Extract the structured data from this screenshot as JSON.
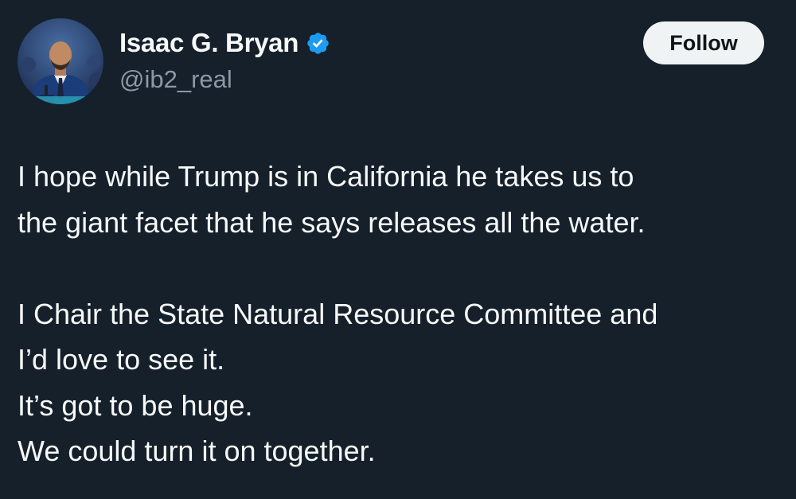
{
  "tweet": {
    "author": {
      "display_name": "Isaac G. Bryan",
      "handle": "@ib2_real",
      "verified": true,
      "verified_color": "#1d9bf0",
      "avatar_icon": "profile-photo-man-at-podium"
    },
    "follow_label": "Follow",
    "paragraphs": [
      {
        "lines": [
          "I hope while Trump is in California he takes us to",
          "the giant facet that he says releases all the water."
        ]
      },
      {
        "lines": [
          "I Chair the State Natural Resource Committee and",
          "I’d love to see it.",
          "It’s got to be huge.",
          "We could turn it on together."
        ]
      }
    ]
  },
  "theme": {
    "background": "#15202b",
    "text_primary": "#f7f9f9",
    "text_secondary": "#8b98a5",
    "button_bg": "#eff3f4",
    "button_text": "#0f1419"
  }
}
